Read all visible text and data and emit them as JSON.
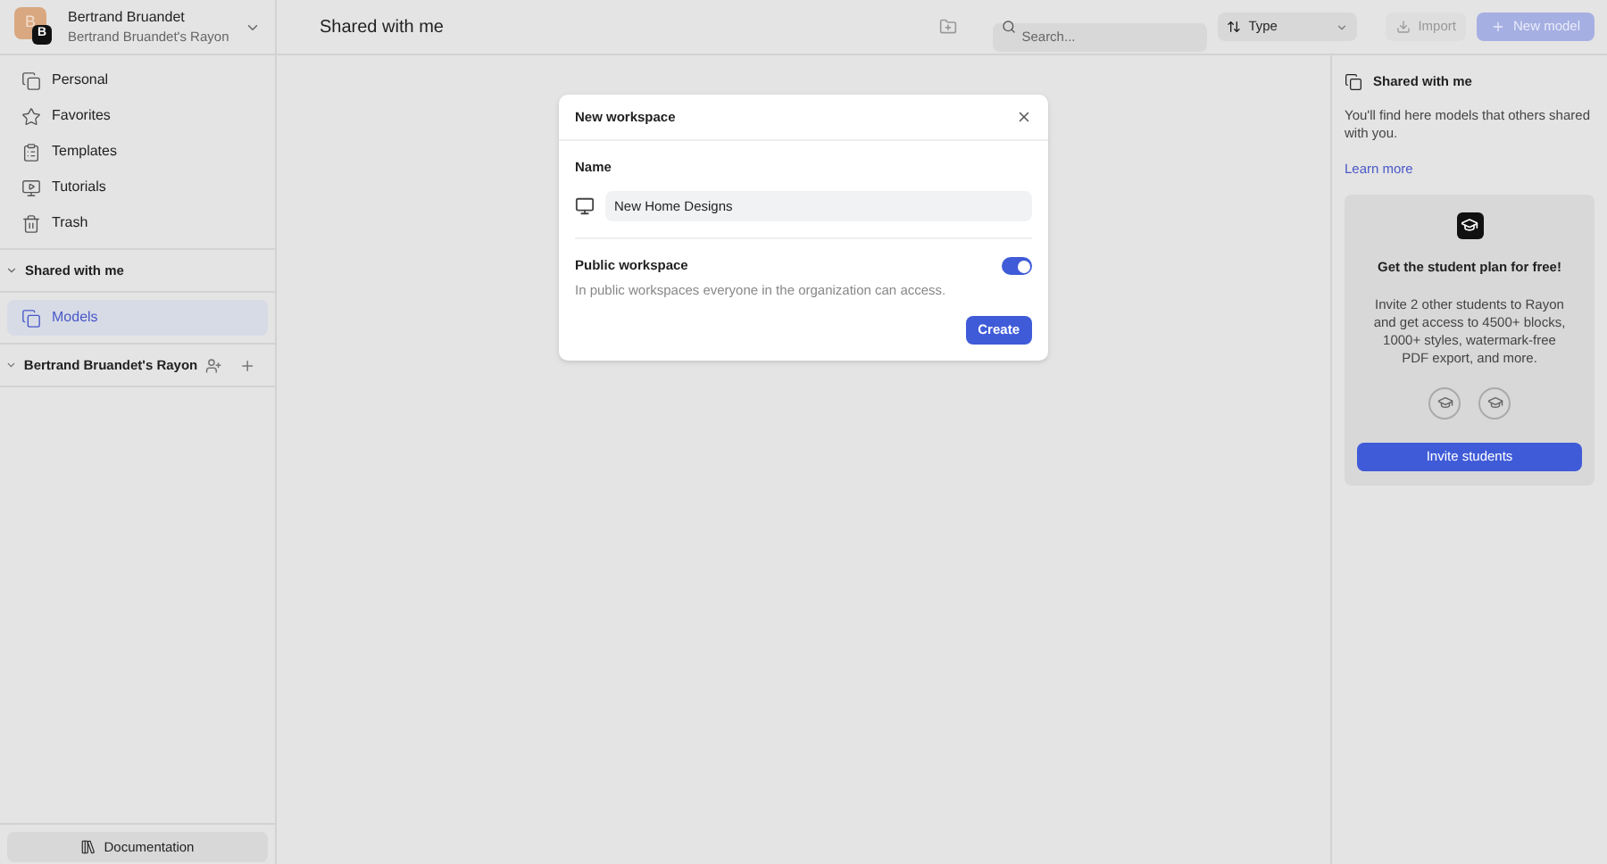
{
  "account": {
    "name": "Bertrand Bruandet",
    "org": "Bertrand Bruandet's Rayon",
    "avatar_letter": "B",
    "badge_letter": "B"
  },
  "sidebar": {
    "items": [
      {
        "label": "Personal",
        "kind": "copy"
      },
      {
        "label": "Favorites",
        "kind": "star"
      },
      {
        "label": "Templates",
        "kind": "clipboard"
      },
      {
        "label": "Tutorials",
        "kind": "video"
      },
      {
        "label": "Trash",
        "kind": "trash"
      }
    ],
    "sections": [
      {
        "title": "Shared with me",
        "expanded": true,
        "actions": false,
        "items": [
          {
            "label": "Models",
            "selected": true
          }
        ]
      },
      {
        "title": "Bertrand Bruandet's Rayon",
        "expanded": true,
        "actions": true
      }
    ],
    "footer_button": "Documentation"
  },
  "page_title": "Shared with me",
  "toolbar": {
    "search": {
      "placeholder": "Search..."
    },
    "sort": "Type",
    "import": "Import",
    "new_model": "New model"
  },
  "dialog": {
    "title": "New workspace",
    "name_label": "Name",
    "name_value": "New Home Designs",
    "public_title": "Public workspace",
    "public_desc": "In public workspaces everyone in the organization can access.",
    "public_on": true,
    "create": "Create"
  },
  "info_panel": {
    "title": "Shared with me",
    "text": "You'll find here models that others shared with you.",
    "link": "Learn more",
    "promo": {
      "title": "Get the student plan for free!",
      "text": "Invite 2 other students to Rayon and get access to 4500+ blocks, 1000+ styles, watermark-free PDF export, and more.",
      "button": "Invite students"
    }
  }
}
